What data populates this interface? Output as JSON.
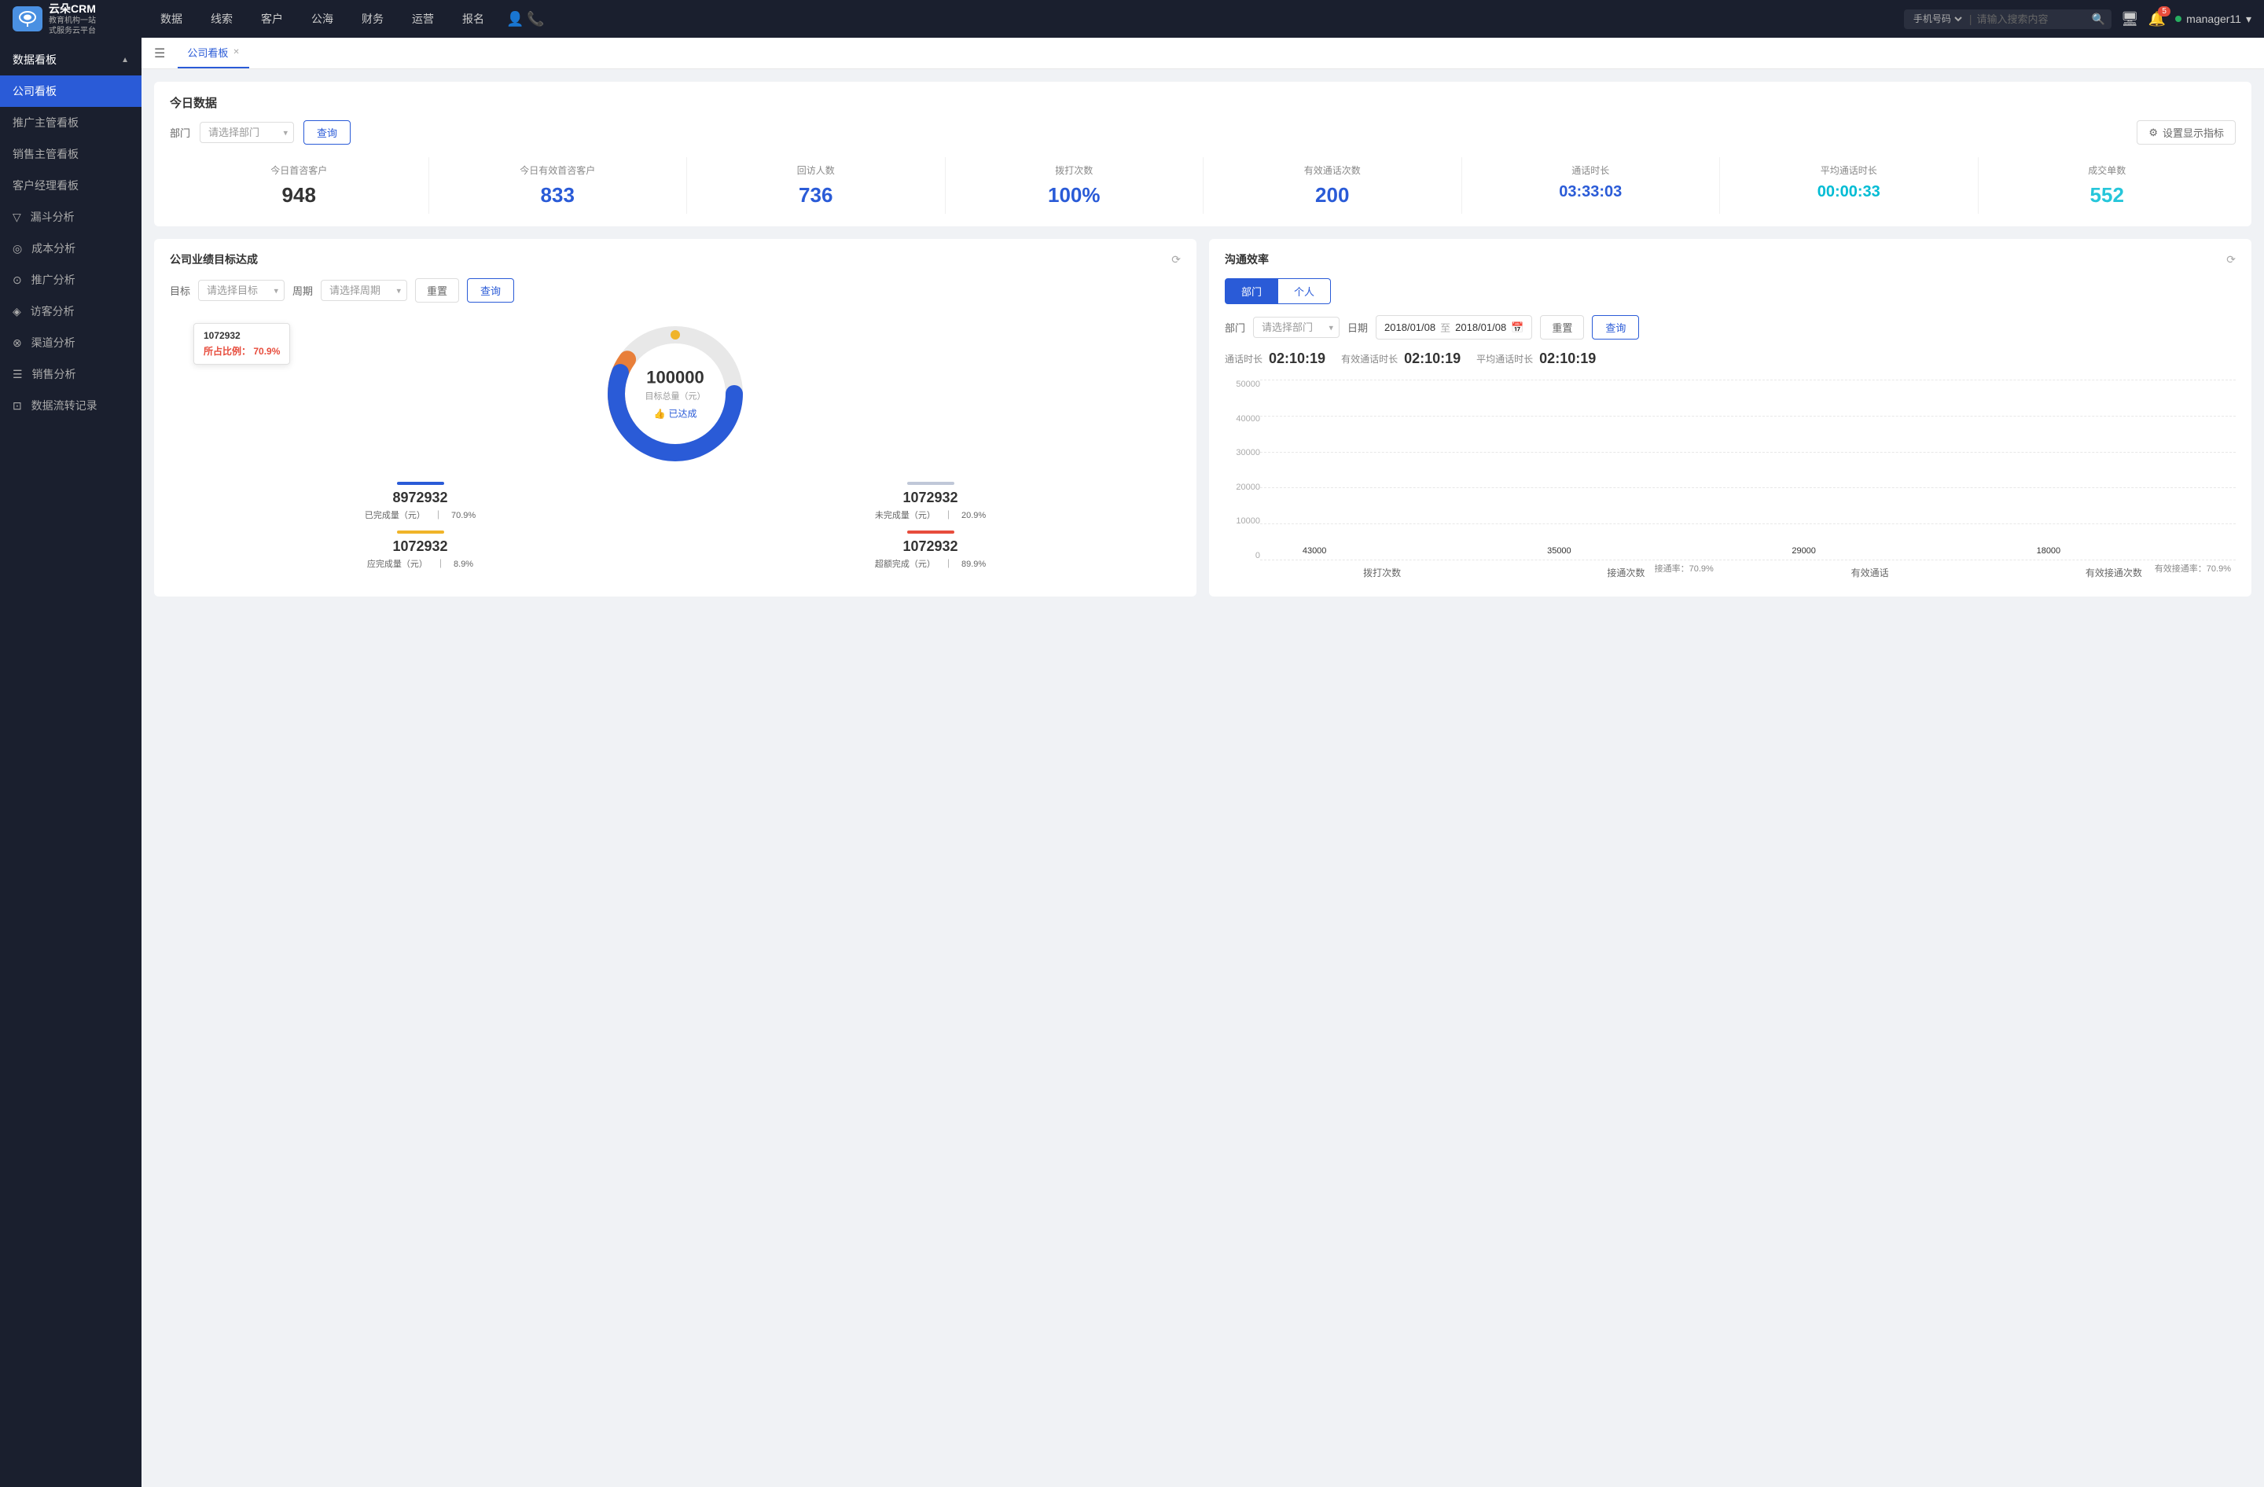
{
  "app": {
    "logo_text1": "云朵CRM",
    "logo_text2": "教育机构一站",
    "logo_text3": "式服务云平台"
  },
  "topnav": {
    "links": [
      "数据",
      "线索",
      "客户",
      "公海",
      "财务",
      "运营",
      "报名"
    ],
    "search_placeholder": "请输入搜索内容",
    "search_type": "手机号码",
    "notification_count": "5",
    "username": "manager11"
  },
  "sidebar": {
    "section_title": "数据看板",
    "active_item": "公司看板",
    "items": [
      {
        "label": "公司看板",
        "active": true
      },
      {
        "label": "推广主管看板",
        "active": false
      },
      {
        "label": "销售主管看板",
        "active": false
      },
      {
        "label": "客户经理看板",
        "active": false
      },
      {
        "label": "漏斗分析",
        "active": false
      },
      {
        "label": "成本分析",
        "active": false
      },
      {
        "label": "推广分析",
        "active": false
      },
      {
        "label": "访客分析",
        "active": false
      },
      {
        "label": "渠道分析",
        "active": false
      },
      {
        "label": "销售分析",
        "active": false
      },
      {
        "label": "数据流转记录",
        "active": false
      }
    ]
  },
  "tabs": {
    "current_tab": "公司看板"
  },
  "today_data": {
    "title": "今日数据",
    "dept_label": "部门",
    "dept_placeholder": "请选择部门",
    "query_btn": "查询",
    "setting_btn": "设置显示指标",
    "stats": [
      {
        "label": "今日首咨客户",
        "value": "948",
        "color": "dark"
      },
      {
        "label": "今日有效首咨客户",
        "value": "833",
        "color": "blue"
      },
      {
        "label": "回访人数",
        "value": "736",
        "color": "blue"
      },
      {
        "label": "拨打次数",
        "value": "100%",
        "color": "blue"
      },
      {
        "label": "有效通话次数",
        "value": "200",
        "color": "blue"
      },
      {
        "label": "通话时长",
        "value": "03:33:03",
        "color": "blue"
      },
      {
        "label": "平均通话时长",
        "value": "00:00:33",
        "color": "cyan"
      },
      {
        "label": "成交单数",
        "value": "552",
        "color": "teal"
      }
    ]
  },
  "target_panel": {
    "title": "公司业绩目标达成",
    "target_label": "目标",
    "target_placeholder": "请选择目标",
    "period_label": "周期",
    "period_placeholder": "请选择周期",
    "reset_btn": "重置",
    "query_btn": "查询",
    "donut": {
      "tooltip_val": "1072932",
      "tooltip_pct_label": "所占比例：",
      "tooltip_pct": "70.9%",
      "center_num": "100000",
      "center_label": "目标总量（元）",
      "center_badge": "已达成"
    },
    "stats": [
      {
        "label": "8972932",
        "sub": "已完成量（元）",
        "pct": "70.9%",
        "color": "#2a5bd7"
      },
      {
        "label": "1072932",
        "sub": "未完成量（元）",
        "pct": "20.9%",
        "color": "#c0c8d8"
      },
      {
        "label": "1072932",
        "sub": "应完成量（元）",
        "pct": "8.9%",
        "color": "#f0b429"
      },
      {
        "label": "1072932",
        "sub": "超额完成（元）",
        "pct": "89.9%",
        "color": "#e74c3c"
      }
    ]
  },
  "comm_panel": {
    "title": "沟通效率",
    "tab_dept": "部门",
    "tab_person": "个人",
    "dept_label": "部门",
    "dept_placeholder": "请选择部门",
    "date_label": "日期",
    "date_from": "2018/01/08",
    "date_to": "2018/01/08",
    "reset_btn": "重置",
    "query_btn": "查询",
    "stats": [
      {
        "label": "通话时长",
        "value": "02:10:19"
      },
      {
        "label": "有效通话时长",
        "value": "02:10:19"
      },
      {
        "label": "平均通话时长",
        "value": "02:10:19"
      }
    ],
    "chart": {
      "y_labels": [
        "50000",
        "40000",
        "30000",
        "20000",
        "10000",
        "0"
      ],
      "x_labels": [
        "拨打次数",
        "接通次数",
        "有效通话",
        "有效接通次数"
      ],
      "bar_groups": [
        {
          "bars": [
            {
              "value": 43000,
              "height_pct": 86,
              "color": "#4a90e2",
              "label": "43000"
            },
            {
              "value": 0,
              "height_pct": 0,
              "color": "#c0c8d8",
              "label": ""
            }
          ]
        },
        {
          "annotation": "接通率：70.9%",
          "bars": [
            {
              "value": 35000,
              "height_pct": 70,
              "color": "#4a90e2",
              "label": "35000"
            },
            {
              "value": 0,
              "height_pct": 8,
              "color": "#c0c8d8",
              "label": ""
            }
          ]
        },
        {
          "bars": [
            {
              "value": 29000,
              "height_pct": 58,
              "color": "#4a90e2",
              "label": "29000"
            },
            {
              "value": 0,
              "height_pct": 0,
              "color": "#c0c8d8",
              "label": ""
            }
          ]
        },
        {
          "annotation": "有效接通率：70.9%",
          "bars": [
            {
              "value": 18000,
              "height_pct": 36,
              "color": "#4a90e2",
              "label": "18000"
            },
            {
              "value": 0,
              "height_pct": 8,
              "color": "#c0c8d8",
              "label": ""
            }
          ]
        }
      ]
    }
  }
}
